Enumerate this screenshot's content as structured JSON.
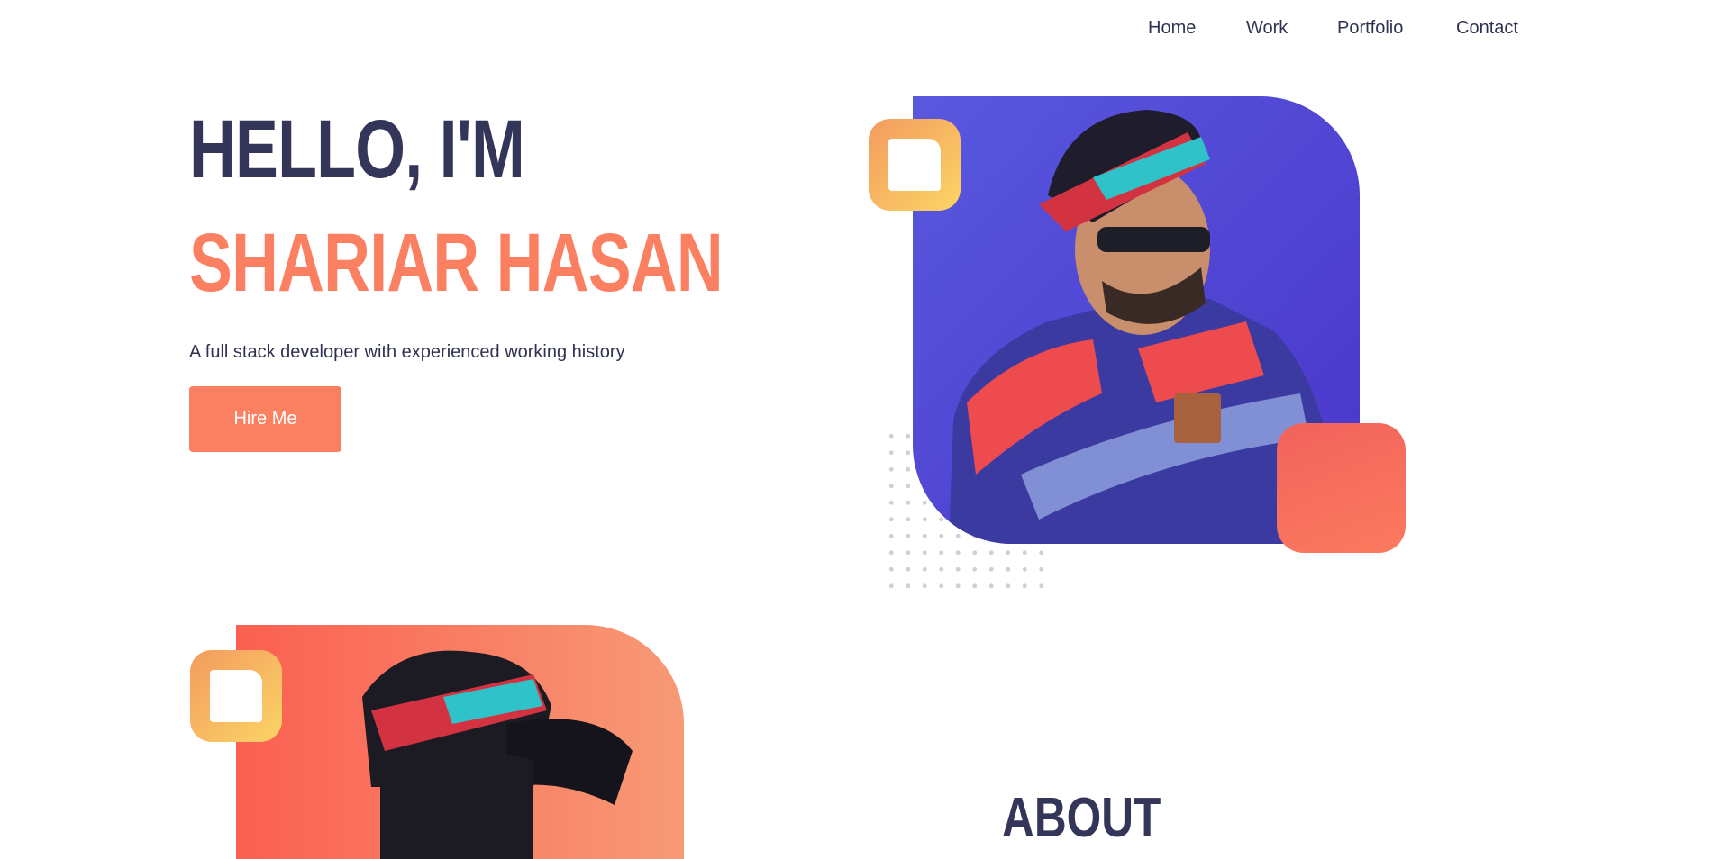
{
  "nav": {
    "items": [
      {
        "label": "Home"
      },
      {
        "label": "Work"
      },
      {
        "label": "Portfolio"
      },
      {
        "label": "Contact"
      }
    ]
  },
  "hero": {
    "greeting": "HELLO, I'M",
    "name": "SHARIAR HASAN",
    "subtitle": "A full stack developer with experienced working history",
    "cta_label": "Hire Me"
  },
  "about": {
    "title": "ABOUT"
  },
  "colors": {
    "accent": "#fb8062",
    "text": "#343659",
    "portrait_bg": "#4a35c9",
    "frame": "#fbd565"
  }
}
